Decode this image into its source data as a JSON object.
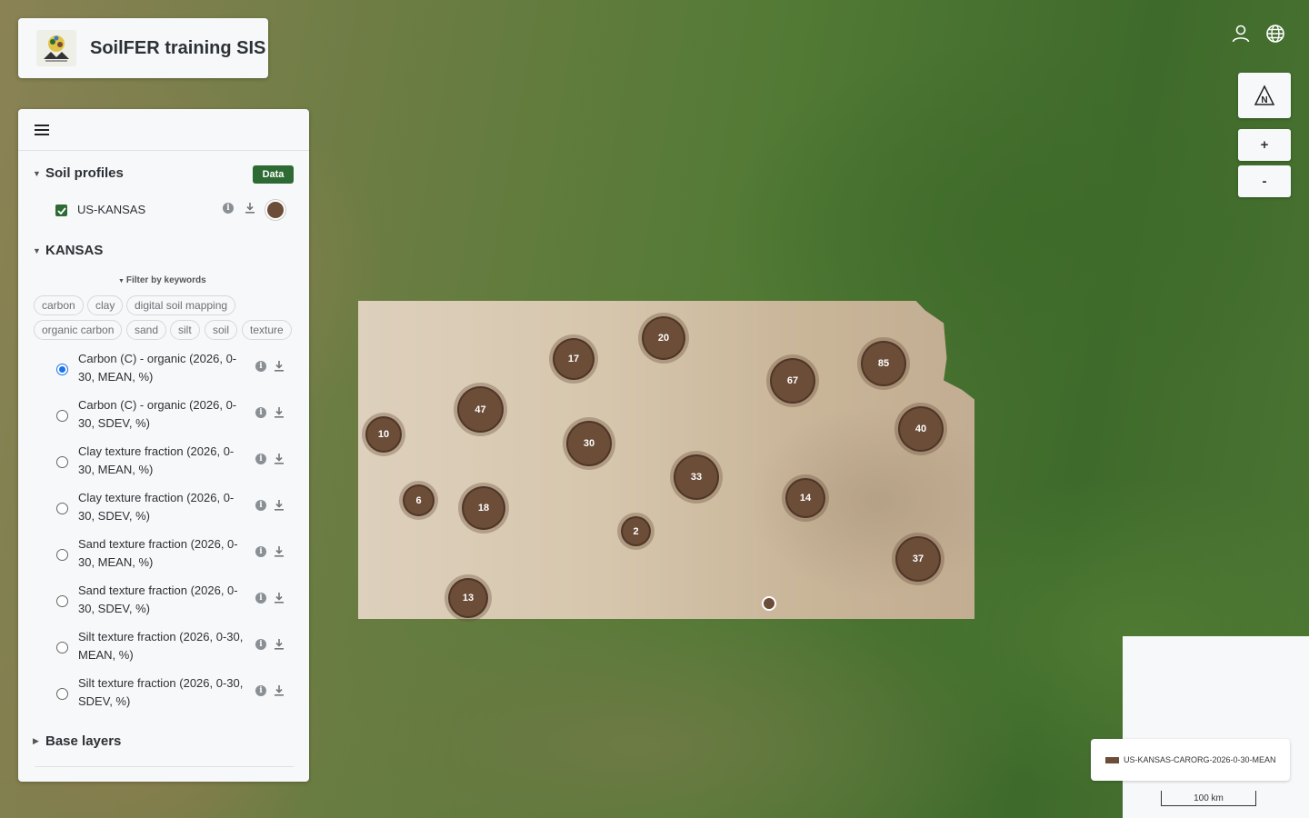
{
  "app": {
    "title": "SoilFER training SIS"
  },
  "sidebar": {
    "soil_profiles": {
      "title": "Soil profiles",
      "badge": "Data",
      "layer": {
        "label": "US-KANSAS",
        "checked": true,
        "color": "#6b4d38"
      }
    },
    "kansas": {
      "title": "KANSAS",
      "filter_label": "Filter by keywords",
      "keywords": [
        "carbon",
        "clay",
        "digital soil mapping",
        "organic carbon",
        "sand",
        "silt",
        "soil",
        "texture"
      ],
      "layers": [
        {
          "line1": "Carbon (C) - organic (2026, 0-",
          "line2": "30, MEAN, %)",
          "selected": true
        },
        {
          "line1": "Carbon (C) - organic (2026, 0-",
          "line2": "30, SDEV, %)",
          "selected": false
        },
        {
          "line1": "Clay texture fraction (2026, 0-",
          "line2": "30, MEAN, %)",
          "selected": false
        },
        {
          "line1": "Clay texture fraction (2026, 0-",
          "line2": "30, SDEV, %)",
          "selected": false
        },
        {
          "line1": "Sand texture fraction (2026, 0-",
          "line2": "30, MEAN, %)",
          "selected": false
        },
        {
          "line1": "Sand texture fraction (2026, 0-",
          "line2": "30, SDEV, %)",
          "selected": false
        },
        {
          "line1": "Silt texture fraction (2026, 0-30,",
          "line2": "MEAN, %)",
          "selected": false
        },
        {
          "line1": "Silt texture fraction (2026, 0-30,",
          "line2": "SDEV, %)",
          "selected": false
        }
      ]
    },
    "base_layers": {
      "title": "Base layers"
    }
  },
  "map_controls": {
    "north_label": "N",
    "zoom_in": "+",
    "zoom_out": "-",
    "icons": [
      "user-icon",
      "globe-icon"
    ]
  },
  "clusters": [
    {
      "count": "20"
    },
    {
      "count": "17"
    },
    {
      "count": "67"
    },
    {
      "count": "85"
    },
    {
      "count": "47"
    },
    {
      "count": "10"
    },
    {
      "count": "30"
    },
    {
      "count": "40"
    },
    {
      "count": "33"
    },
    {
      "count": "14"
    },
    {
      "count": "6"
    },
    {
      "count": "18"
    },
    {
      "count": "2"
    },
    {
      "count": "37"
    },
    {
      "count": "13"
    }
  ],
  "legend": {
    "label": "US-KANSAS-CARORG-2026-0-30-MEAN",
    "color": "#6b4d38"
  },
  "scale": {
    "label": "100 km"
  },
  "colors": {
    "brand_green": "#2e6b34",
    "profile_brown": "#6b4d38",
    "radio_blue": "#1a73e8"
  }
}
